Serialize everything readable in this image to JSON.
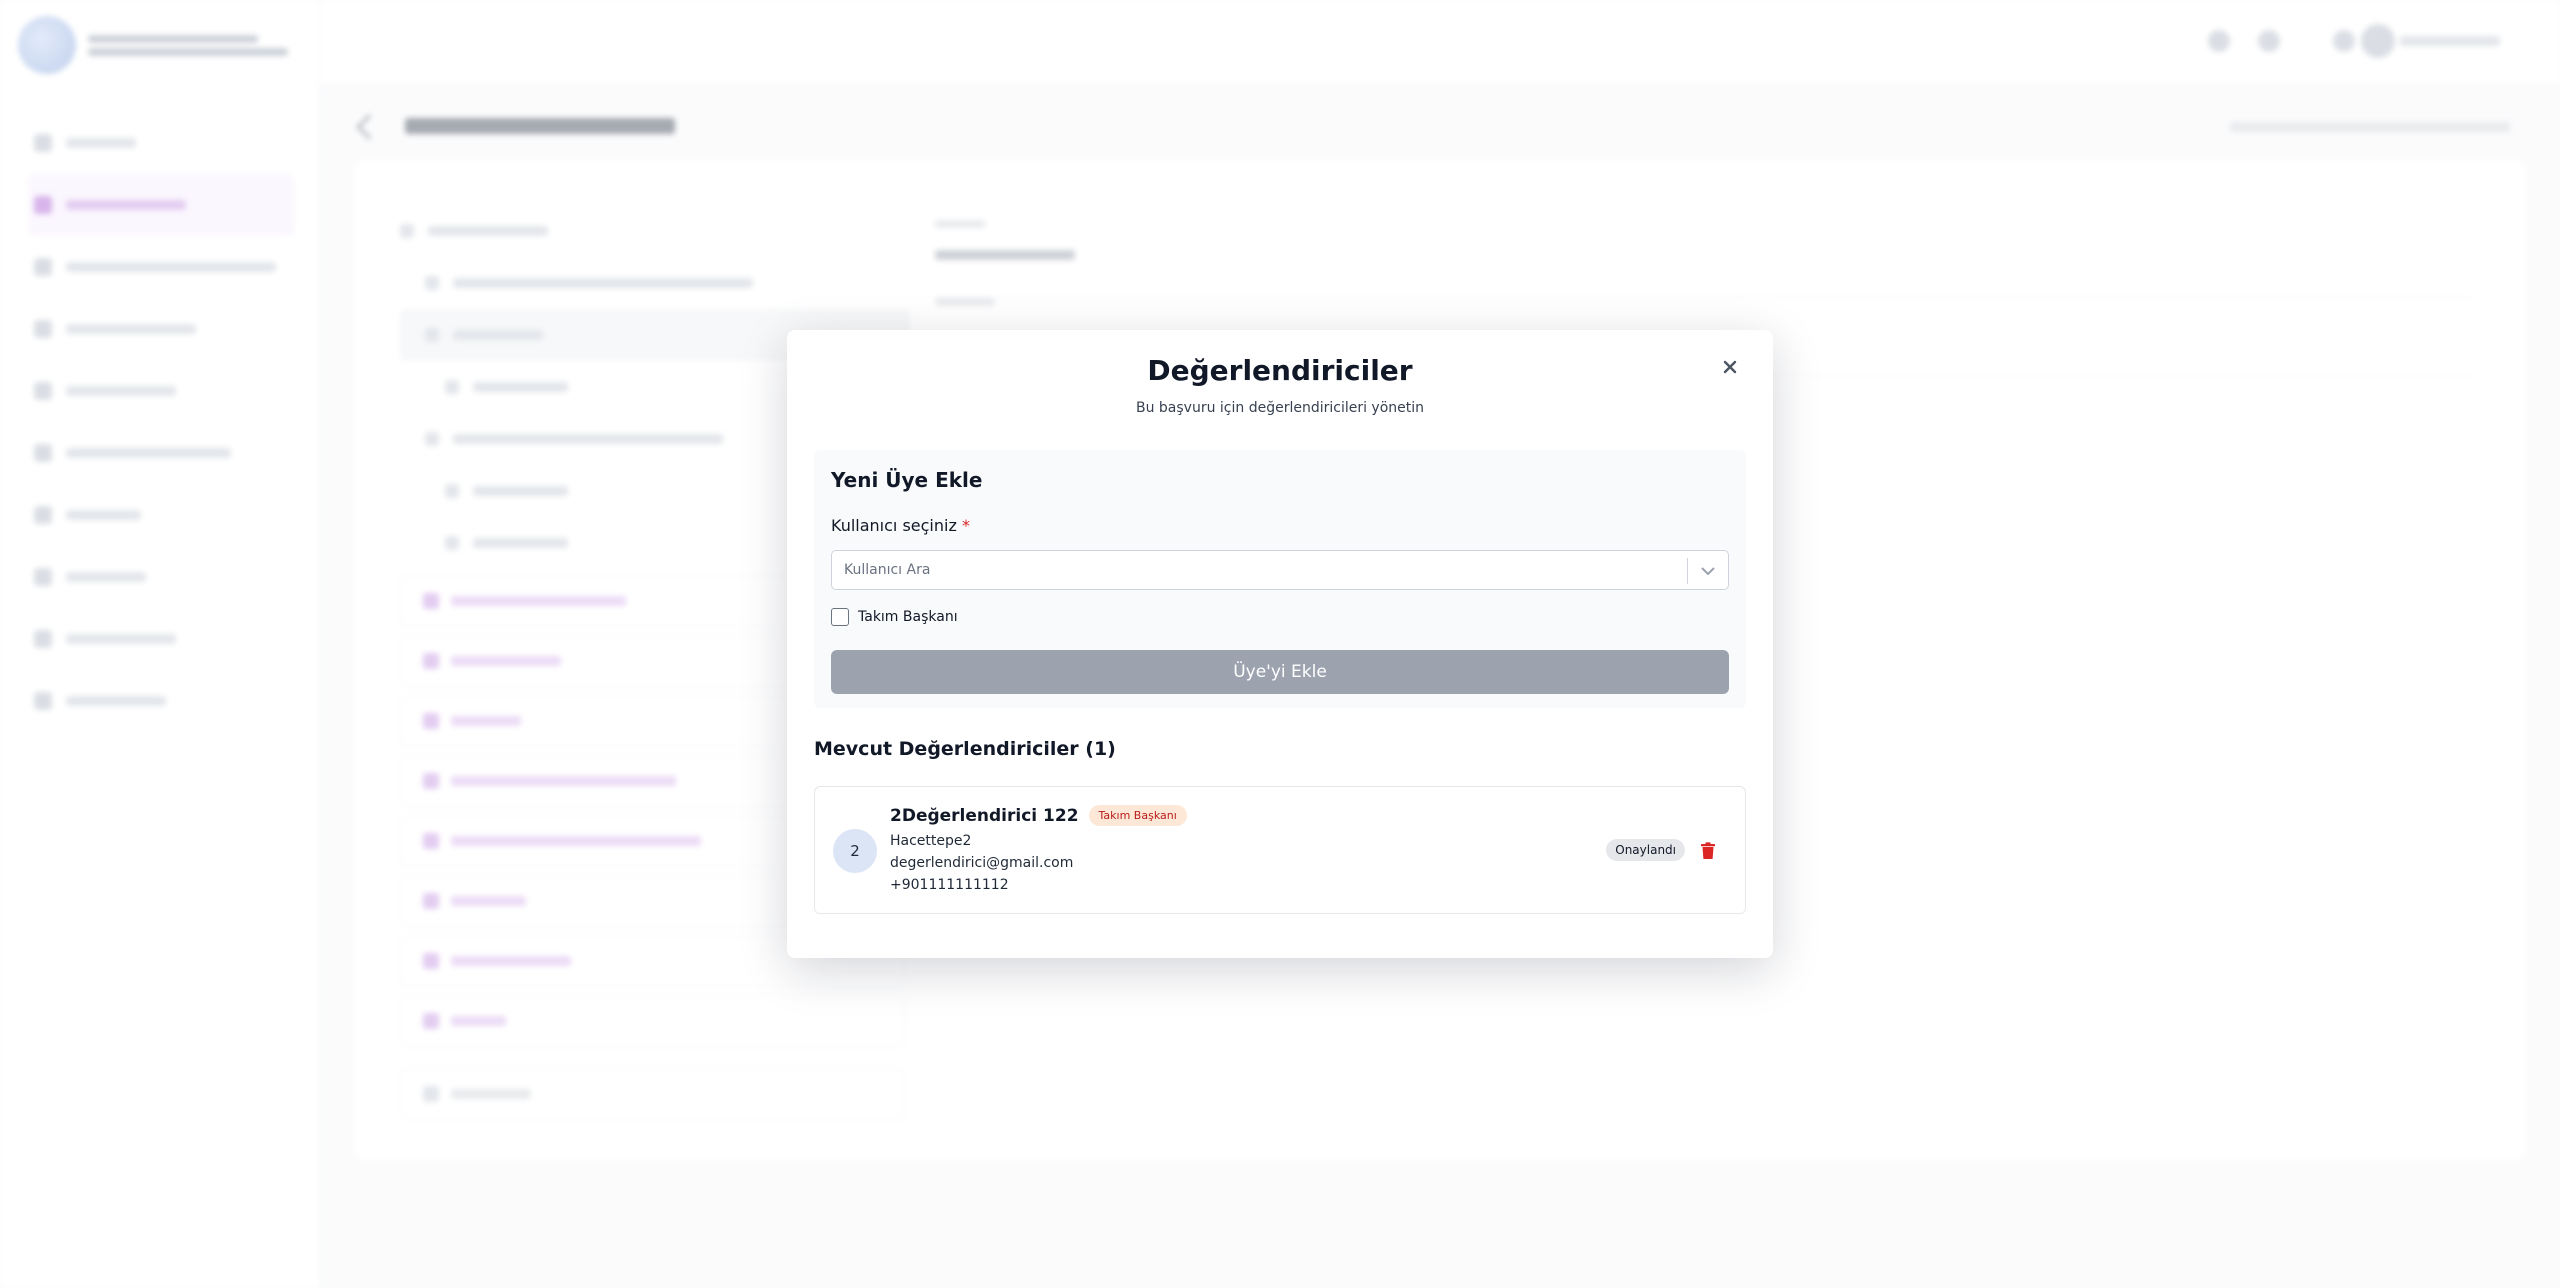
{
  "modal": {
    "title": "Değerlendiriciler",
    "subtitle": "Bu başvuru için değerlendiricileri yönetin",
    "add_section": {
      "title": "Yeni Üye Ekle",
      "user_label": "Kullanıcı seçiniz",
      "required_mark": "*",
      "search_placeholder": "Kullanıcı Ara",
      "leader_checkbox_label": "Takım Başkanı",
      "add_button_label": "Üye'yi Ekle"
    },
    "existing_section": {
      "title": "Mevcut Değerlendiriciler (1)",
      "members": [
        {
          "avatar_initial": "2",
          "name": "2Değerlendirici 122",
          "role_badge": "Takım Başkanı",
          "organization": "Hacettepe2",
          "email": "degerlendirici@gmail.com",
          "phone": "+901111111112",
          "status": "Onaylandı"
        }
      ]
    }
  },
  "colors": {
    "required": "#dc2626",
    "delete": "#dc2626",
    "disabled_button": "#9ca3af",
    "leader_badge_bg": "#fde7d6",
    "leader_badge_text": "#b91c1c",
    "accent": "#b06ad6"
  },
  "icons": {
    "close": "close-icon",
    "select_arrow": "chevron-down-icon",
    "delete": "trash-icon"
  }
}
